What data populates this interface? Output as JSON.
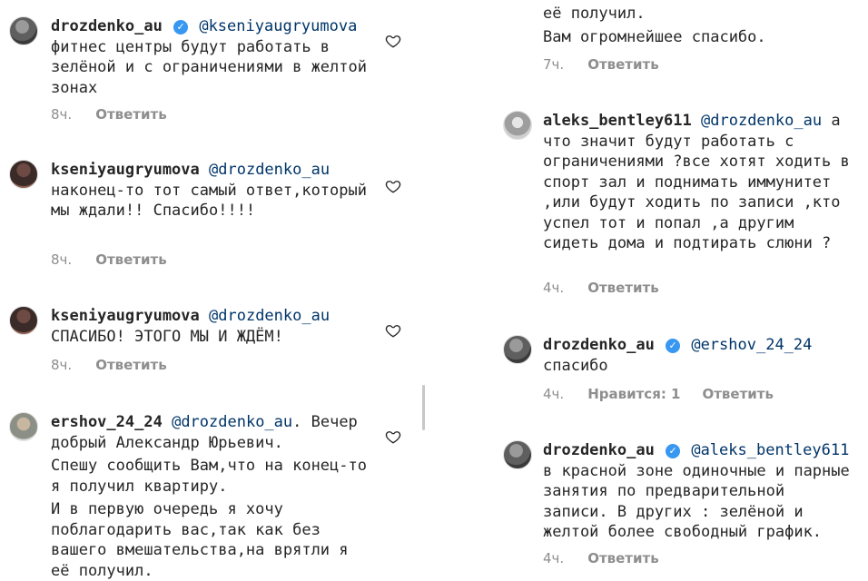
{
  "left_column": {
    "comments": [
      {
        "username": "drozdenko_au",
        "verified": true,
        "mention": "@kseniyaugryumova",
        "paragraphs": [
          "фитнес центры будут работать в зелёной и с ограничениями в желтой зонах"
        ],
        "time": "8ч.",
        "likes": "",
        "reply_label": "Ответить"
      },
      {
        "username": "kseniyaugryumova",
        "verified": false,
        "mention": "@drozdenko_au",
        "paragraphs": [
          "наконец-то тот самый ответ,который мы ждали!! Спасибо!!!!"
        ],
        "time": "8ч.",
        "likes": "",
        "reply_label": "Ответить"
      },
      {
        "username": "kseniyaugryumova",
        "verified": false,
        "mention": "@drozdenko_au",
        "paragraphs": [
          "СПАСИБО! ЭТОГО МЫ И ЖДЁМ!"
        ],
        "time": "8ч.",
        "likes": "",
        "reply_label": "Ответить"
      },
      {
        "username": "ershov_24_24",
        "verified": false,
        "mention": "@drozdenko_au",
        "paragraphs": [
          ". Вечер добрый Александр Юрьевич.",
          "Спешу сообщить Вам,что на конец-то я получил квартиру.",
          "И в первую очередь я хочу поблагодарить вас,так как без вашего вмешательства,на врятли я её получил."
        ],
        "time": "",
        "likes": "",
        "reply_label": ""
      }
    ]
  },
  "right_column": {
    "comments": [
      {
        "username": "",
        "verified": false,
        "mention": "",
        "paragraphs": [
          "её получил.",
          "Вам огромнейшее спасибо."
        ],
        "time": "7ч.",
        "likes": "",
        "reply_label": "Ответить"
      },
      {
        "username": "aleks_bentley611",
        "verified": false,
        "mention": "@drozdenko_au",
        "paragraphs": [
          "а что значит будут работать с ограничениями ?все хотят ходить в спорт зал и поднимать иммунитет ,или будут ходить по записи ,кто успел тот и попал ,а другим сидеть дома и подтирать слюни ?"
        ],
        "time": "4ч.",
        "likes": "",
        "reply_label": "Ответить"
      },
      {
        "username": "drozdenko_au",
        "verified": true,
        "mention": "@ershov_24_24",
        "paragraphs": [
          "спасибо"
        ],
        "time": "4ч.",
        "likes": "Нравится: 1",
        "reply_label": "Ответить"
      },
      {
        "username": "drozdenko_au",
        "verified": true,
        "mention": "@aleks_bentley611",
        "paragraphs": [
          "в красной зоне одиночные и парные занятия по предварительной записи. В других : зелёной и желтой более свободный график."
        ],
        "time": "4ч.",
        "likes": "",
        "reply_label": "Ответить"
      }
    ]
  },
  "icons": {
    "like": "heart-outline-icon",
    "verified": "verified-badge-icon"
  },
  "colors": {
    "text": "#262626",
    "mention": "#003569",
    "meta": "#8e8e8e",
    "verified": "#3897f0"
  }
}
